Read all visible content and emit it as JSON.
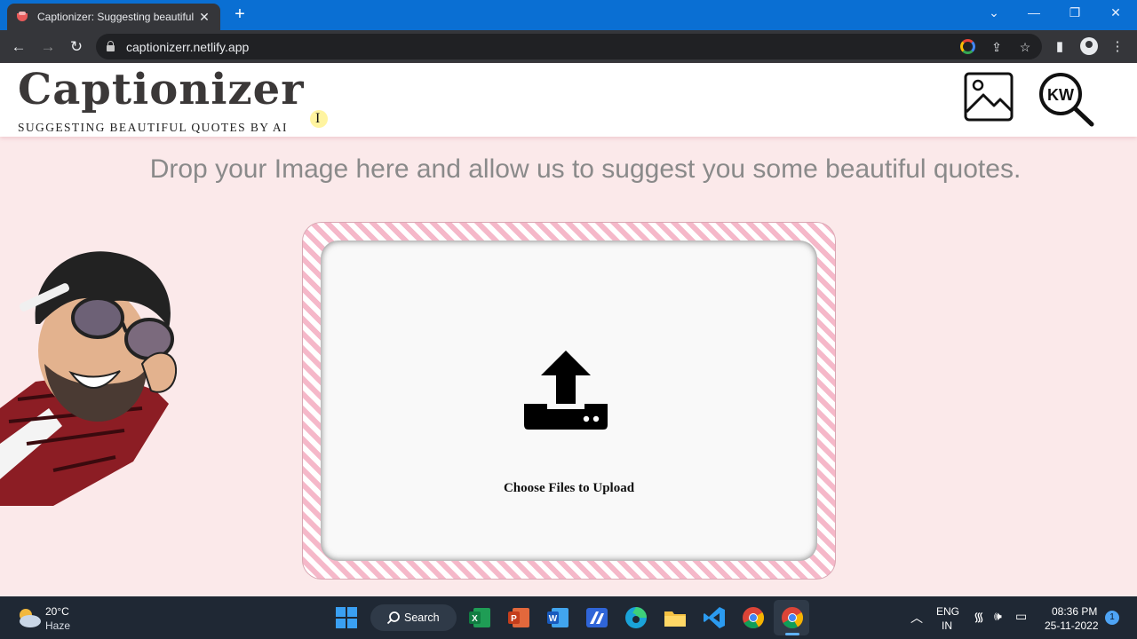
{
  "browser": {
    "tab_title": "Captionizer: Suggesting beautiful quotes by AI",
    "tab_close": "✕",
    "new_tab": "+",
    "url": "captionizerr.netlify.app"
  },
  "site": {
    "logo": "Captionizer",
    "tagline": "SUGGESTING BEAUTIFUL QUOTES BY AI",
    "cursor_glyph": "I",
    "headline": "Drop your Image here and allow us to suggest you some beautiful quotes.",
    "upload_label": "Choose Files to Upload",
    "kw_icon_text": "KW"
  },
  "taskbar": {
    "weather_temp": "20°C",
    "weather_desc": "Haze",
    "search_label": "Search",
    "lang_top": "ENG",
    "lang_bottom": "IN",
    "time": "08:36 PM",
    "date": "25-11-2022",
    "notification_count": "1"
  },
  "colors": {
    "tabbar": "#0a6fd3",
    "page_bg": "#fbe9ea",
    "stripe_pink": "#f5b8c9",
    "headline": "#8a8a8a",
    "taskbar": "#1f2834"
  }
}
